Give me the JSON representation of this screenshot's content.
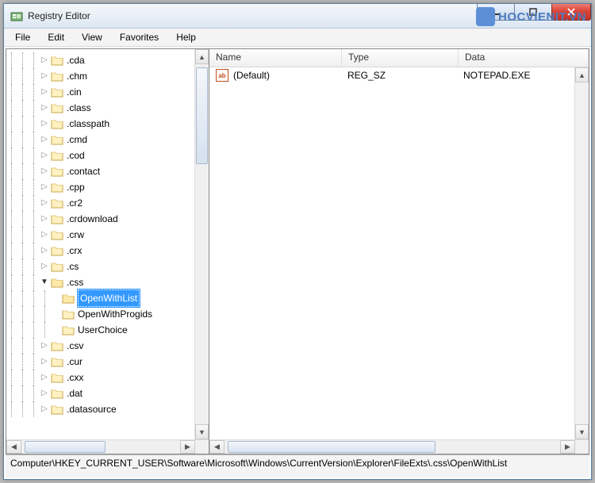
{
  "window": {
    "title": "Registry Editor"
  },
  "menu": {
    "file": "File",
    "edit": "Edit",
    "view": "View",
    "favorites": "Favorites",
    "help": "Help"
  },
  "tree": {
    "items": [
      {
        "level": 3,
        "expander": "collapsed",
        "label": ".cda"
      },
      {
        "level": 3,
        "expander": "collapsed",
        "label": ".chm"
      },
      {
        "level": 3,
        "expander": "collapsed",
        "label": ".cin"
      },
      {
        "level": 3,
        "expander": "collapsed",
        "label": ".class"
      },
      {
        "level": 3,
        "expander": "collapsed",
        "label": ".classpath"
      },
      {
        "level": 3,
        "expander": "collapsed",
        "label": ".cmd"
      },
      {
        "level": 3,
        "expander": "collapsed",
        "label": ".cod"
      },
      {
        "level": 3,
        "expander": "collapsed",
        "label": ".contact"
      },
      {
        "level": 3,
        "expander": "collapsed",
        "label": ".cpp"
      },
      {
        "level": 3,
        "expander": "collapsed",
        "label": ".cr2"
      },
      {
        "level": 3,
        "expander": "collapsed",
        "label": ".crdownload"
      },
      {
        "level": 3,
        "expander": "collapsed",
        "label": ".crw"
      },
      {
        "level": 3,
        "expander": "collapsed",
        "label": ".crx"
      },
      {
        "level": 3,
        "expander": "collapsed",
        "label": ".cs"
      },
      {
        "level": 3,
        "expander": "expanded",
        "label": ".css"
      },
      {
        "level": 4,
        "expander": "none",
        "label": "OpenWithList",
        "selected": true
      },
      {
        "level": 4,
        "expander": "none",
        "label": "OpenWithProgids"
      },
      {
        "level": 4,
        "expander": "none",
        "label": "UserChoice"
      },
      {
        "level": 3,
        "expander": "collapsed",
        "label": ".csv"
      },
      {
        "level": 3,
        "expander": "collapsed",
        "label": ".cur"
      },
      {
        "level": 3,
        "expander": "collapsed",
        "label": ".cxx"
      },
      {
        "level": 3,
        "expander": "collapsed",
        "label": ".dat"
      },
      {
        "level": 3,
        "expander": "collapsed",
        "label": ".datasource"
      }
    ]
  },
  "list": {
    "columns": {
      "name": "Name",
      "type": "Type",
      "data": "Data"
    },
    "rows": [
      {
        "name": "(Default)",
        "type": "REG_SZ",
        "data": "NOTEPAD.EXE"
      }
    ]
  },
  "statusbar": {
    "path": "Computer\\HKEY_CURRENT_USER\\Software\\Microsoft\\Windows\\CurrentVersion\\Explorer\\FileExts\\.css\\OpenWithList"
  },
  "watermark": {
    "text": "HOCVIENIT.VN"
  }
}
